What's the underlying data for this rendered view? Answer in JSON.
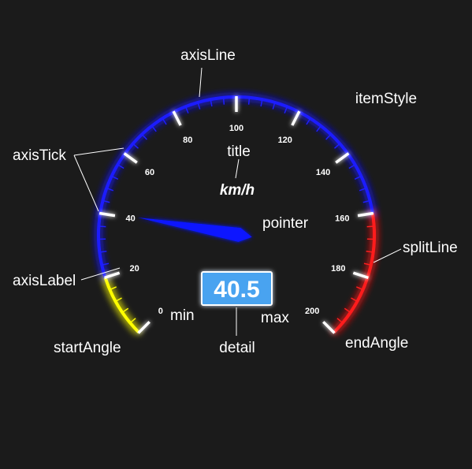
{
  "chart_data": {
    "type": "gauge",
    "min": 0,
    "max": 200,
    "value": 40.5,
    "unit": "km/h",
    "detail": "40.5",
    "tick_labels": [
      "0",
      "20",
      "40",
      "60",
      "80",
      "100",
      "120",
      "140",
      "160",
      "180",
      "200"
    ],
    "axis_line_colors": [
      {
        "upto": 0.1,
        "color": "#ffff00"
      },
      {
        "upto": 0.8,
        "color": "#1e1eff"
      },
      {
        "upto": 1.0,
        "color": "#ff1e1e"
      }
    ],
    "detail_background": "#4aa3f0",
    "pointer_color": "#0a14ff"
  },
  "annotations": {
    "axisLine": "axisLine",
    "itemStyle": "itemStyle",
    "axisTick": "axisTick",
    "title": "title",
    "pointer": "pointer",
    "splitLine": "splitLine",
    "axisLabel": "axisLabel",
    "min": "min",
    "max": "max",
    "startAngle": "startAngle",
    "detail": "detail",
    "endAngle": "endAngle"
  }
}
